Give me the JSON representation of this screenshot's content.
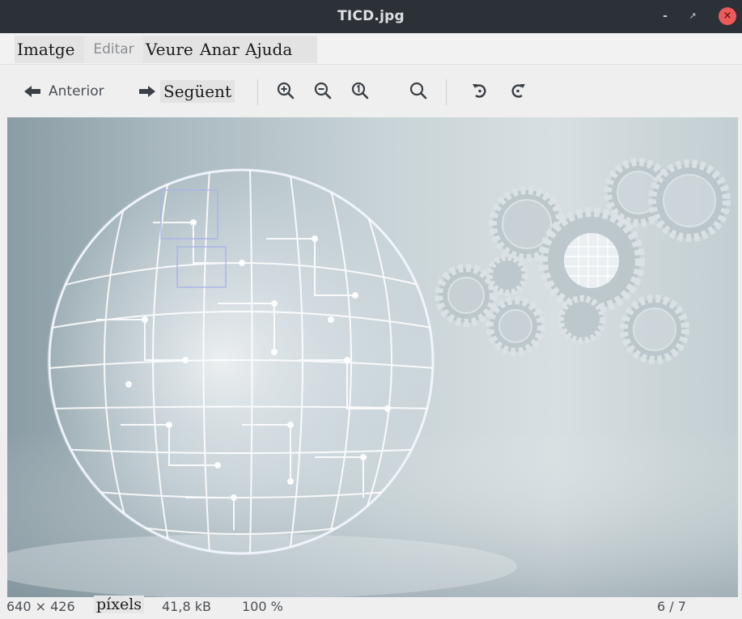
{
  "window": {
    "title": "TICD.jpg",
    "controls": {
      "minimize": "-",
      "maximize": "↗",
      "close": "×"
    }
  },
  "menu": {
    "items": [
      "Imatge",
      "Editar",
      "Veure",
      "Anar",
      "Ajuda"
    ]
  },
  "toolbar": {
    "prev_label": "Anterior",
    "next_label": "Següent",
    "icons": [
      "arrow-left-icon",
      "arrow-right-icon",
      "zoom-in-icon",
      "zoom-out-icon",
      "zoom-original-icon",
      "zoom-fit-icon",
      "rotate-left-icon",
      "rotate-right-icon"
    ]
  },
  "status": {
    "dimensions": "640 × 426",
    "unit": "píxels",
    "size": "41,8 kB",
    "zoom": "100 %",
    "position": "6 / 7"
  },
  "colors": {
    "titlebar": "#2b3137",
    "close_button": "#ee5a5a",
    "menubar": "#f2f2f2",
    "toolbar": "#efefef"
  }
}
